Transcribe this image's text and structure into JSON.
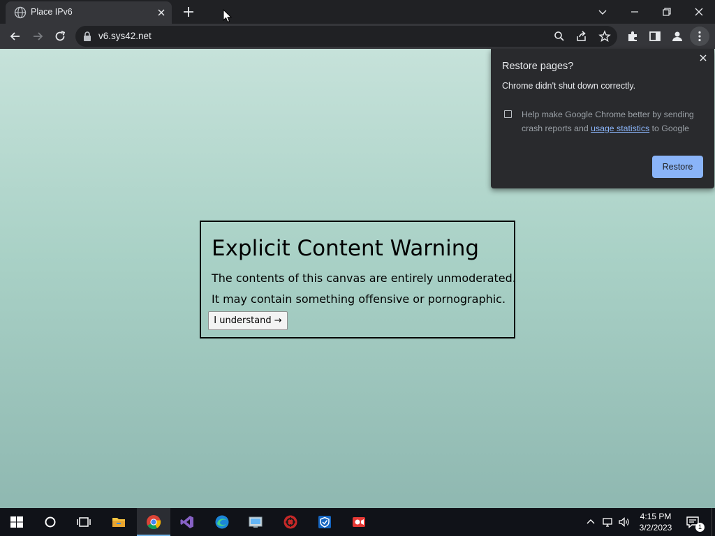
{
  "browser": {
    "tab_title": "Place IPv6",
    "url": "v6.sys42.net",
    "icons": {
      "favicon": "globe-icon",
      "tab_close": "close-icon",
      "new_tab": "plus-icon",
      "back": "arrow-left-icon",
      "forward": "arrow-right-icon",
      "reload": "reload-icon",
      "lock": "lock-icon",
      "zoom": "search-icon",
      "share": "share-icon",
      "bookmark": "star-icon",
      "extensions": "puzzle-icon",
      "side_panel": "side-panel-icon",
      "profile": "profile-icon",
      "menu": "kebab-icon"
    }
  },
  "warning": {
    "title": "Explicit Content Warning",
    "line1": "The contents of this canvas are entirely unmoderated.",
    "line2": "It may contain something offensive or pornographic.",
    "button_label": "I understand →"
  },
  "restore_popup": {
    "title": "Restore pages?",
    "subtitle": "Chrome didn't shut down correctly.",
    "checkbox_text_before": "Help make Google Chrome better by sending crash reports and",
    "checkbox_link": "usage statistics",
    "checkbox_text_after": "to Google",
    "button_label": "Restore",
    "accent_color": "#8ab4f8"
  },
  "taskbar": {
    "apps": [
      "start-icon",
      "cortana-icon",
      "task-view-icon",
      "file-explorer-icon",
      "chrome-icon",
      "visual-studio-icon",
      "edge-icon",
      "control-panel-icon",
      "app-red-icon",
      "app-shield-icon",
      "app-recorder-icon"
    ],
    "active_app": "chrome-icon",
    "time": "4:15 PM",
    "date": "3/2/2023",
    "notification_count": "1"
  }
}
